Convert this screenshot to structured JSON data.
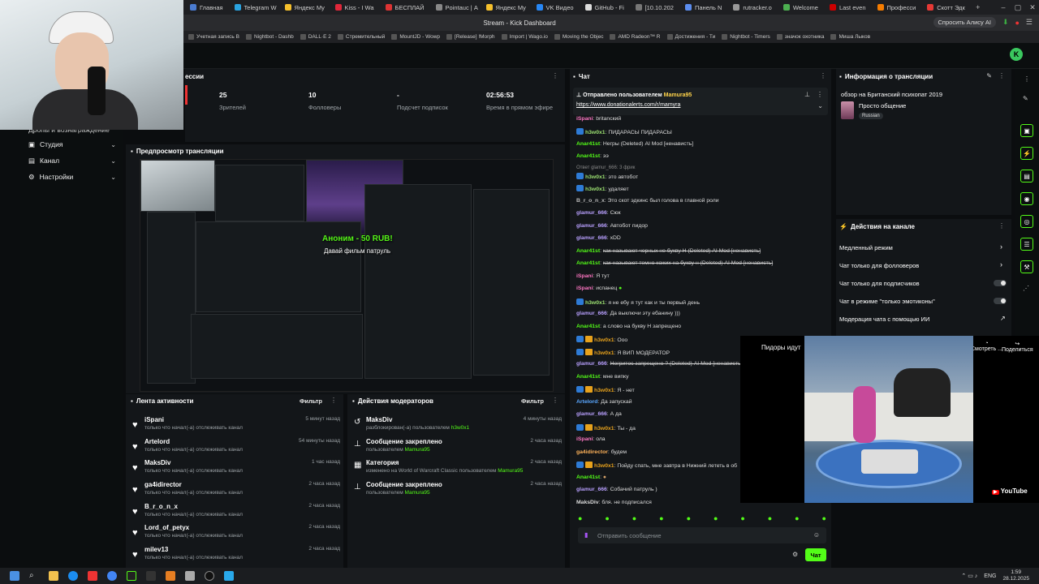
{
  "browser": {
    "tabs": [
      "Главная",
      "Telegram W",
      "Яндекс Му",
      "Kiss - I Wa",
      "БЕСПЛАЙ",
      "Pointauc | А",
      "Яндекс Му",
      "VK Видео",
      "GitHub - Fi",
      "[10.10.202",
      "Панель N",
      "rutracker.o",
      "Welcome",
      "Last even",
      "Професси",
      "Скотт Эдк"
    ],
    "window_title": "Stream - Kick Dashboard",
    "alice_label": "Спросить Алису AI",
    "bookmarks": [
      "Учетная запись B",
      "Nightbot - Dashb",
      "DALL·E 2",
      "Стремительный",
      "MountJD - Wowp",
      "[Release] !Morph",
      "Import | Wago.io",
      "Moving the Objec",
      "AMD Radeon™ R",
      "Достижения - Ти",
      "Nightbot - Timers",
      "значок охотника",
      "Миша Лыков"
    ]
  },
  "sidebar": {
    "partial_label": "Дропы и вознаграждение",
    "items": [
      {
        "label": "Студия",
        "icon": "studio-icon"
      },
      {
        "label": "Канал",
        "icon": "channel-icon"
      },
      {
        "label": "Настройки",
        "icon": "settings-icon"
      }
    ]
  },
  "session": {
    "title": "ессии",
    "stats": [
      {
        "value": "25",
        "label": "Зрителей"
      },
      {
        "value": "10",
        "label": "Фолловеры"
      },
      {
        "value": "-",
        "label": "Подсчет подписок"
      },
      {
        "value": "02:56:53",
        "label": "Время в прямом эфире"
      }
    ]
  },
  "preview": {
    "title": "Предпросмотр трансляции",
    "alert_title": "Аноним - 50 RUB!",
    "alert_message": "Давай фильм патруль"
  },
  "activity": {
    "title": "Лента активности",
    "filter": "Фильтр",
    "rows": [
      {
        "name": "iSpani",
        "desc": "только что начал(-а) отслеживать канал",
        "time": "5 минут назад"
      },
      {
        "name": "Artelord",
        "desc": "только что начал(-а) отслеживать канал",
        "time": "54 минуты назад"
      },
      {
        "name": "MaksDiv",
        "desc": "только что начал(-а) отслеживать канал",
        "time": "1 час назад"
      },
      {
        "name": "ga4idirector",
        "desc": "только что начал(-а) отслеживать канал",
        "time": "2 часа назад"
      },
      {
        "name": "B_r_o_n_x",
        "desc": "только что начал(-а) отслеживать канал",
        "time": "2 часа назад"
      },
      {
        "name": "Lord_of_petyx",
        "desc": "только что начал(-а) отслеживать канал",
        "time": "2 часа назад"
      },
      {
        "name": "milev13",
        "desc": "только что начал(-а) отслеживать канал",
        "time": "2 часа назад"
      }
    ]
  },
  "mod_actions": {
    "title": "Действия модераторов",
    "filter": "Фильтр",
    "rows": [
      {
        "name": "MaksDiv",
        "desc": "разблокирован(-а) пользователем",
        "user": "h3w0x1",
        "time": "4 минуты назад"
      },
      {
        "name": "Сообщение закреплено",
        "desc": "пользователем",
        "user": "Mamura95",
        "time": "2 часа назад"
      },
      {
        "name": "Категория",
        "desc": "изменено на World of Warcraft Classic пользователем",
        "user": "Mamura95",
        "time": "2 часа назад"
      },
      {
        "name": "Сообщение закреплено",
        "desc": "пользователем",
        "user": "Mamura95",
        "time": "2 часа назад"
      }
    ]
  },
  "chat": {
    "title": "Чат",
    "pinned_by_label": "Отправлено пользователем",
    "pinned_user": "Mamura95",
    "pinned_link": "https://www.donationalerts.com/r/mamyra",
    "input_placeholder": "Отправить сообщение",
    "send_label": "Чат",
    "reply_note": "Ответ glamur_666: 3 фрик",
    "messages": [
      {
        "user": "iSpani",
        "text": "britanский"
      },
      {
        "user": "h3w0x1",
        "text": "ПИДАРАСЫ ПИДАРАСЫ"
      },
      {
        "user": "Anar41st",
        "text": "Негры (Deleted) AI Mod [ненависть]"
      },
      {
        "user": "Anar41st",
        "text": "ээ"
      },
      {
        "user": "h3w0x1",
        "text": "это автобот"
      },
      {
        "user": "h3w0x1",
        "text": "удаляет"
      },
      {
        "user": "B_r_o_n_x",
        "text": "Это скот эдкинс был голова в главной роли"
      },
      {
        "user": "glamur_666",
        "text": "Сюк"
      },
      {
        "user": "glamur_666",
        "text": "Автобот пидор"
      },
      {
        "user": "glamur_666",
        "text": "xDD"
      },
      {
        "user": "Anar41st",
        "text": "как называют черных не букву Н (Deleted) AI Mod [ненависть]"
      },
      {
        "user": "Anar41st",
        "text": "как называют темно кожих на букву н (Deleted) AI Mod [ненависть]"
      },
      {
        "user": "iSpani",
        "text": "Я тут"
      },
      {
        "user": "iSpani",
        "text": "испанец"
      },
      {
        "user": "h3w0x1",
        "text": "я не ебу я тут как и ты первый день"
      },
      {
        "user": "glamur_666",
        "text": "Да выключи эту ебанину )))"
      },
      {
        "user": "Anar41st",
        "text": "а слово на букву Н запрещено"
      },
      {
        "user": "h3w0x1",
        "text": "Ооо"
      },
      {
        "user": "h3w0x1",
        "text": "Я ВИП МОДЕРАТОР"
      },
      {
        "user": "glamur_666",
        "text": "Негритос запрещено ? (Deleted) AI Mod [ненависть]"
      },
      {
        "user": "Anar41st",
        "text": "мне випку"
      },
      {
        "user": "h3w0x1",
        "text": "Я - нет"
      },
      {
        "user": "Artelord",
        "text": "Да запускай"
      },
      {
        "user": "glamur_666",
        "text": "А да"
      },
      {
        "user": "h3w0x1",
        "text": "Ты - да"
      },
      {
        "user": "iSpani",
        "text": "ола"
      },
      {
        "user": "ga4idirector",
        "text": "будем"
      },
      {
        "user": "h3w0x1",
        "text": "Пойду спать, мне завтра в Нижний лететь в об"
      },
      {
        "user": "Anar41st",
        "text": ""
      },
      {
        "user": "glamur_666",
        "text": "Собачий патруль )"
      },
      {
        "user": "MaksDiv",
        "text": "бля. не подписался"
      }
    ]
  },
  "stream_info": {
    "title": "Информация о трансляции",
    "stream_title": "обзор на Британский психопат 2019",
    "category": "Просто общение",
    "language": "Russian"
  },
  "channel_actions": {
    "title": "Действия на канале",
    "items": [
      {
        "label": "Медленный режим",
        "control": "arrow"
      },
      {
        "label": "Чат только для фолловеров",
        "control": "arrow"
      },
      {
        "label": "Чат только для подписчиков",
        "control": "toggle"
      },
      {
        "label": "Чат в режиме \"только эмотиконы\"",
        "control": "toggle"
      },
      {
        "label": "Модерация чата с помощью ИИ",
        "control": "external"
      }
    ]
  },
  "youtube_overlay": {
    "title": "Пидоры идут",
    "watch_later": "Смотреть ...",
    "share": "Поделиться",
    "logo": "YouTube"
  },
  "taskbar": {
    "lang": "ENG",
    "time": "1:59",
    "date": "28.12.2025"
  },
  "colors": {
    "kick_green": "#53fc18",
    "panel_bg": "#131619",
    "page_bg": "#0b0d0f"
  }
}
